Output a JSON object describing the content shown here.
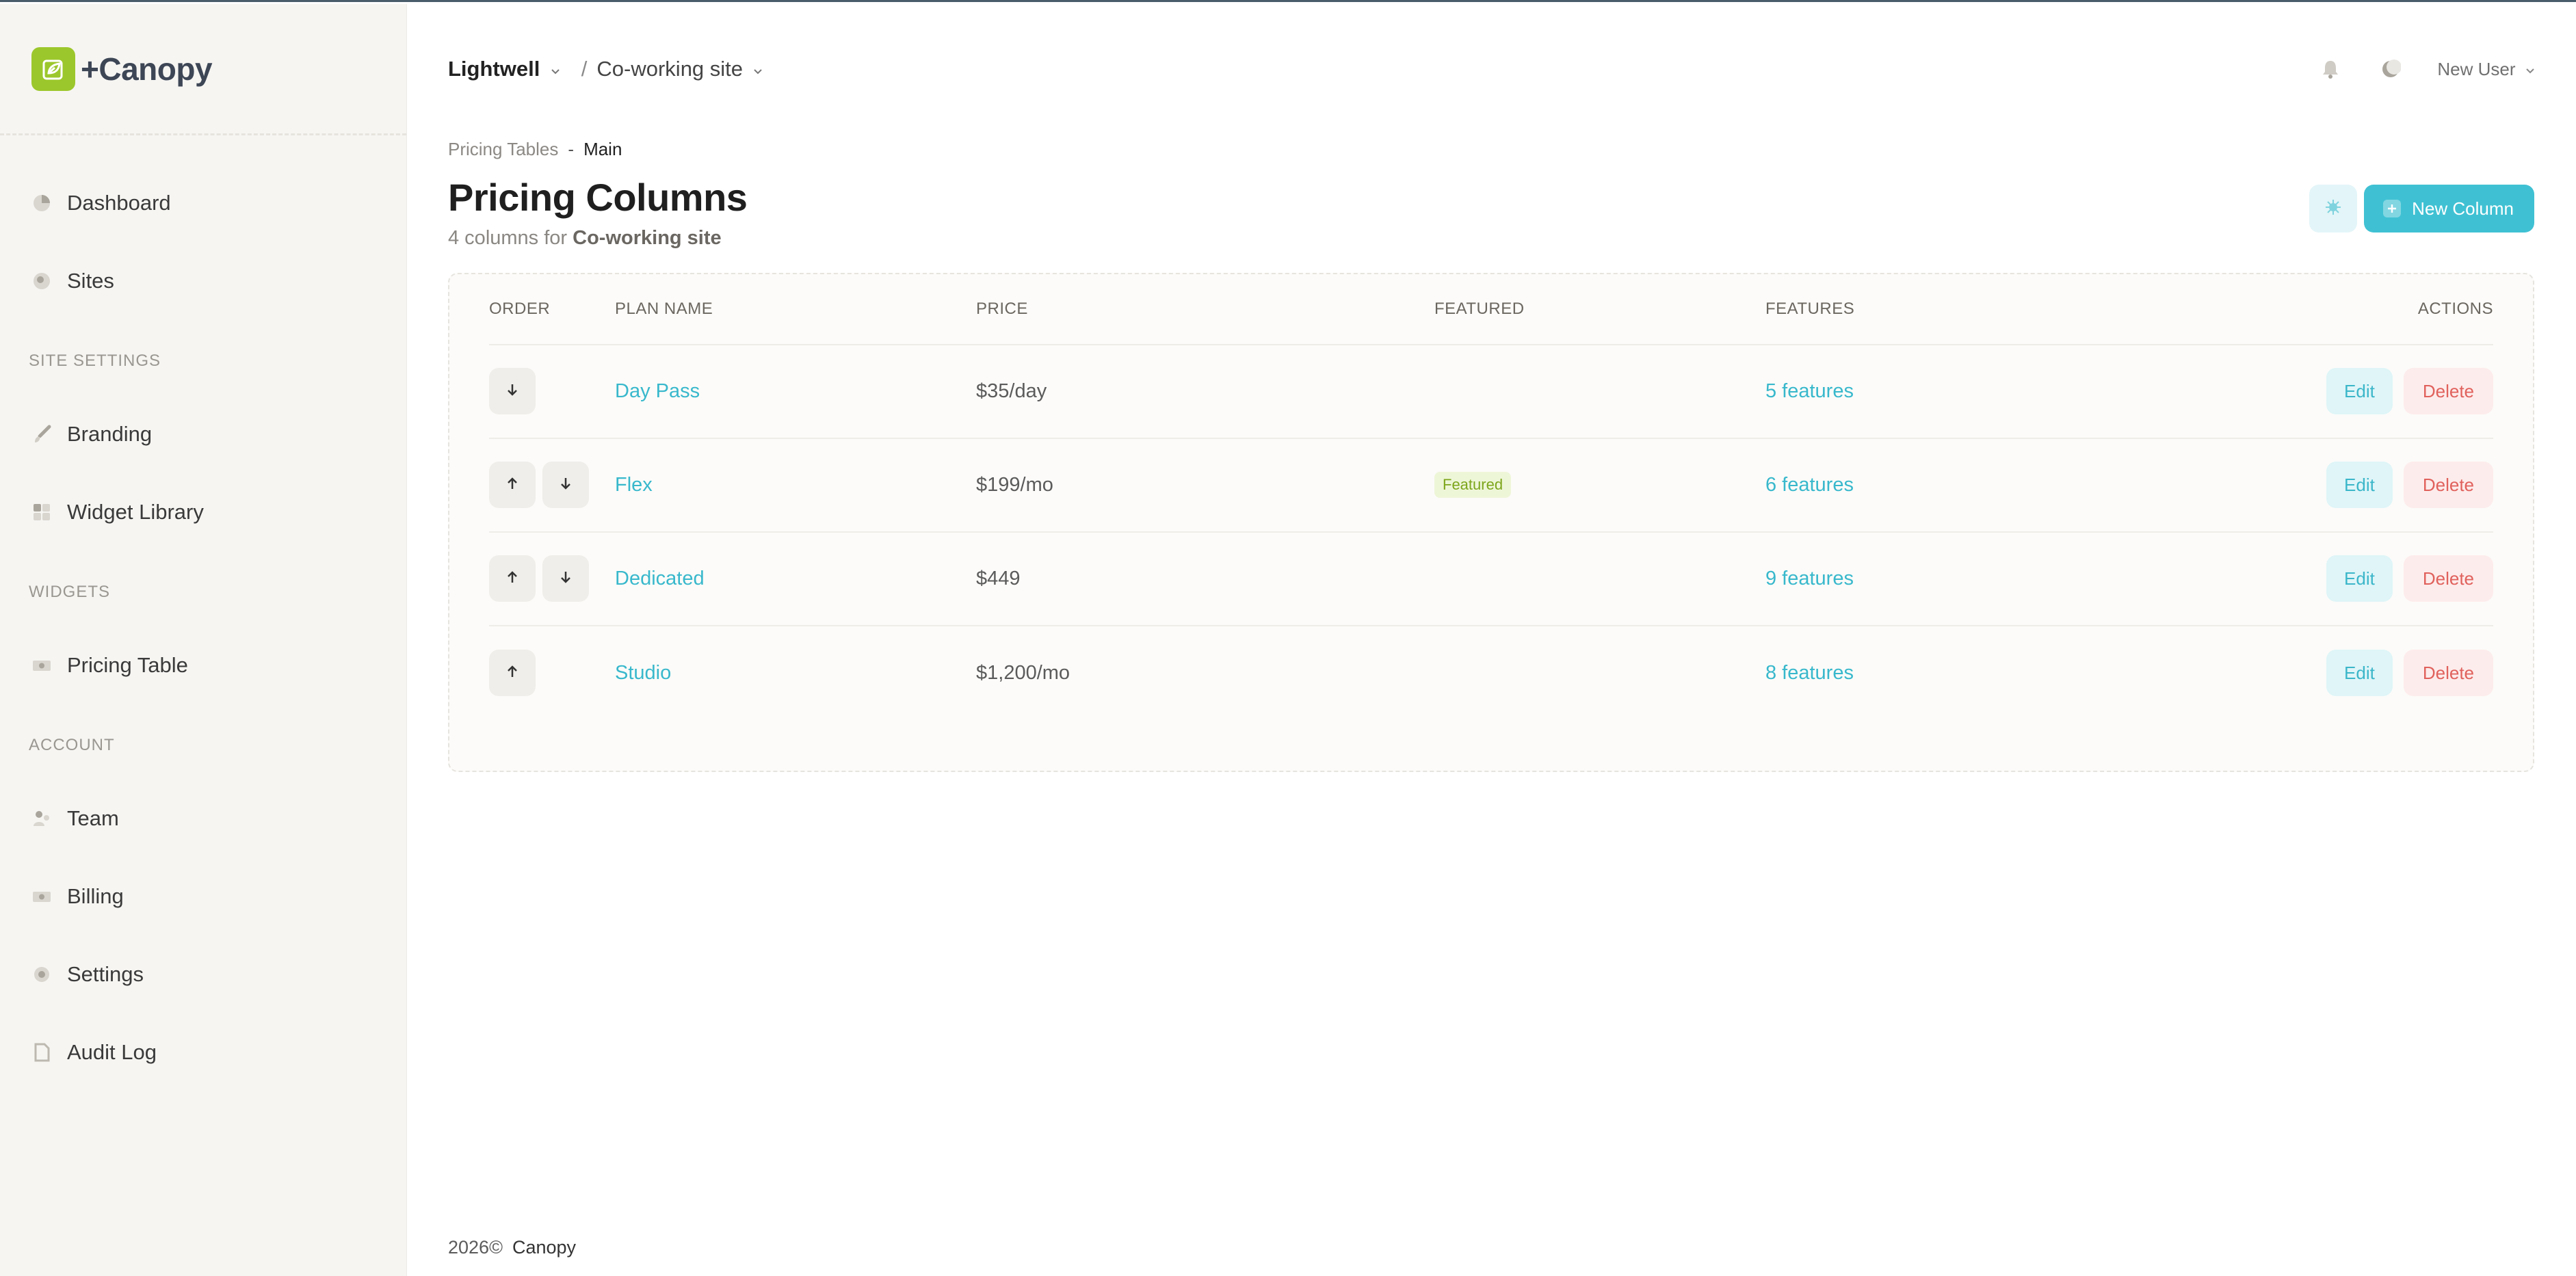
{
  "brand": {
    "name": "+Canopy"
  },
  "sidebar": {
    "items": [
      {
        "label": "Dashboard",
        "icon": "pie-chart-icon"
      },
      {
        "label": "Sites",
        "icon": "globe-icon"
      }
    ],
    "sections": [
      {
        "heading": "SITE SETTINGS",
        "items": [
          {
            "label": "Branding",
            "icon": "brush-icon"
          },
          {
            "label": "Widget Library",
            "icon": "grid-icon"
          }
        ]
      },
      {
        "heading": "WIDGETS",
        "items": [
          {
            "label": "Pricing Table",
            "icon": "money-icon"
          }
        ]
      },
      {
        "heading": "ACCOUNT",
        "items": [
          {
            "label": "Team",
            "icon": "team-icon"
          },
          {
            "label": "Billing",
            "icon": "money-icon"
          },
          {
            "label": "Settings",
            "icon": "gear-icon"
          },
          {
            "label": "Audit Log",
            "icon": "document-icon"
          }
        ]
      }
    ]
  },
  "topbar": {
    "org": "Lightwell",
    "separator": "/",
    "site": "Co-working site",
    "user": "New User"
  },
  "breadcrumb": {
    "parent": "Pricing Tables",
    "separator": "-",
    "current": "Main"
  },
  "page": {
    "title": "Pricing Columns",
    "subtitle_prefix": "4 columns for",
    "subtitle_site": "Co-working site",
    "new_button": "New Column"
  },
  "table": {
    "headers": {
      "order": "ORDER",
      "name": "PLAN NAME",
      "price": "PRICE",
      "featured": "FEATURED",
      "features": "FEATURES",
      "actions": "ACTIONS"
    },
    "rows": [
      {
        "name": "Day Pass",
        "price": "$35/day",
        "featured": "",
        "features": "5 features",
        "edit": "Edit",
        "delete": "Delete"
      },
      {
        "name": "Flex",
        "price": "$199/mo",
        "featured": "Featured",
        "features": "6 features",
        "edit": "Edit",
        "delete": "Delete"
      },
      {
        "name": "Dedicated",
        "price": "$449",
        "featured": "",
        "features": "9 features",
        "edit": "Edit",
        "delete": "Delete"
      },
      {
        "name": "Studio",
        "price": "$1,200/mo",
        "featured": "",
        "features": "8 features",
        "edit": "Edit",
        "delete": "Delete"
      }
    ]
  },
  "footer": {
    "year": "2026©",
    "company": "Canopy"
  },
  "colors": {
    "accent": "#3fc1d3",
    "brand": "#9cc72c",
    "danger": "#e0615c",
    "featured_badge": "#7da61c"
  }
}
